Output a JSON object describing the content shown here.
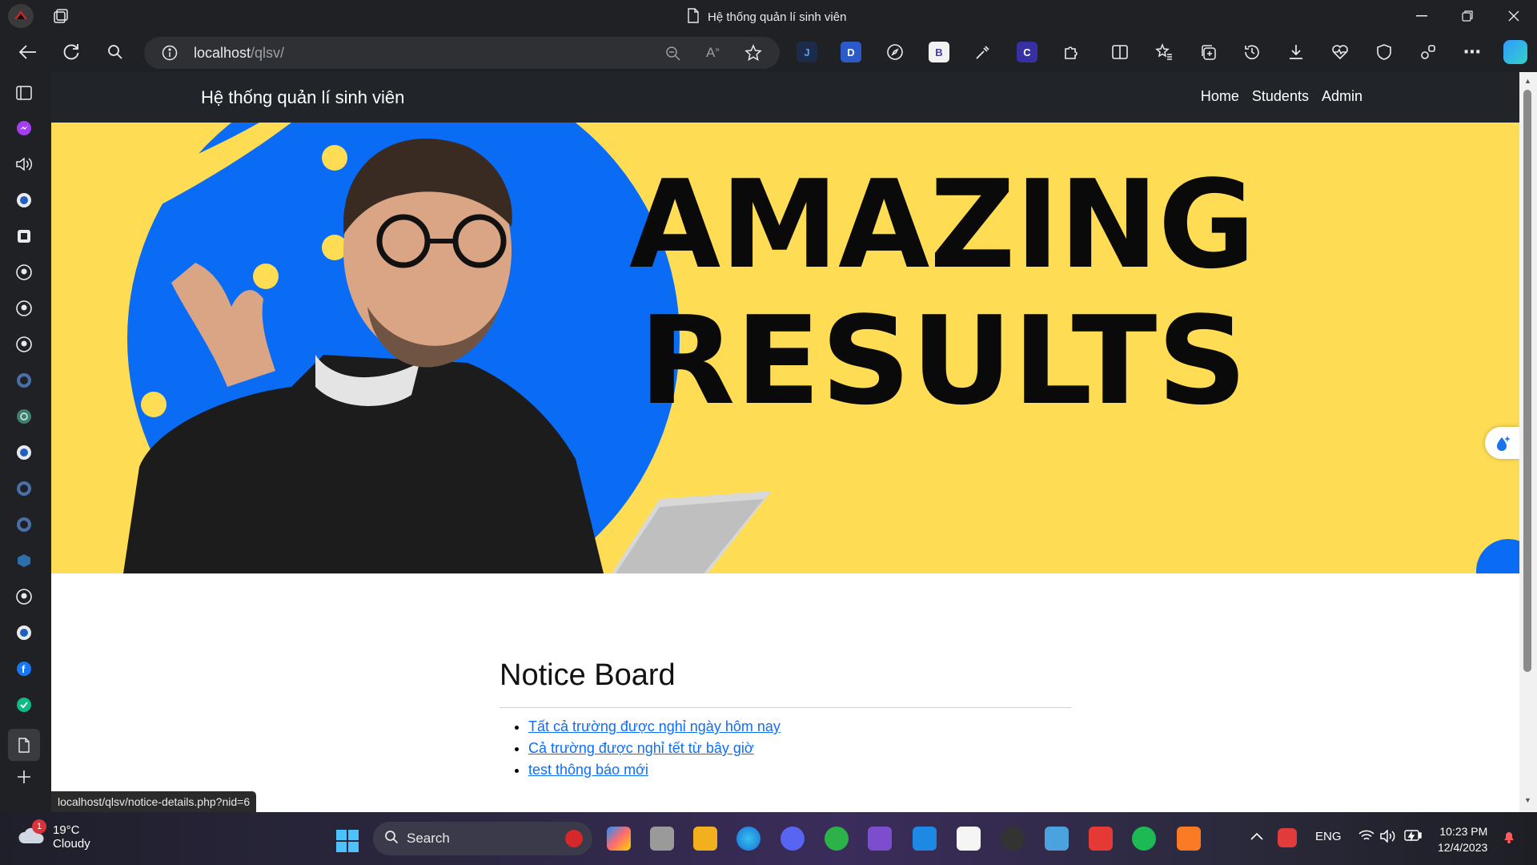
{
  "browser": {
    "tab_title": "Hệ thống quản lí sinh viên",
    "url_host": "localhost",
    "url_path": "/qlsv/",
    "status_url": "localhost/qlsv/notice-details.php?nid=6"
  },
  "site": {
    "brand": "Hệ thống quản lí sinh viên",
    "nav": [
      "Home",
      "Students",
      "Admin"
    ]
  },
  "hero": {
    "line1": "AMAZING",
    "line2": "RESULTS"
  },
  "notice_board": {
    "title": "Notice Board",
    "items": [
      "Tất cả trường được nghỉ ngày hôm nay",
      "Cả trường được nghỉ tết từ bây giờ",
      "test thông báo mới"
    ]
  },
  "taskbar": {
    "weather_temp": "19°C",
    "weather_cond": "Cloudy",
    "weather_badge": "1",
    "search_label": "Search",
    "language": "ENG",
    "time": "10:23 PM",
    "date": "12/4/2023"
  },
  "colors": {
    "hero_yellow": "#fedd55",
    "hero_blue": "#0a6cf5",
    "navbar": "#212529",
    "link": "#0d6efd"
  }
}
